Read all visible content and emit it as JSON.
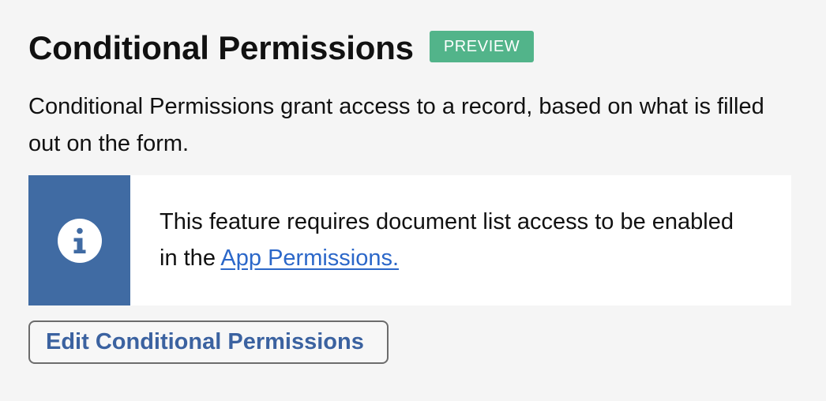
{
  "header": {
    "title": "Conditional Permissions",
    "badge": "PREVIEW"
  },
  "description": "Conditional Permissions grant access to a record, based on what is filled out on the form.",
  "notice": {
    "icon": "info-icon",
    "text_prefix": "This feature requires document list access to be enabled in the ",
    "link_label": "App Permissions."
  },
  "actions": {
    "edit_label": "Edit Conditional Permissions"
  },
  "colors": {
    "badge_bg": "#52b48a",
    "notice_side": "#406ba3",
    "link": "#2b67c9",
    "button_text": "#3b62a0"
  }
}
